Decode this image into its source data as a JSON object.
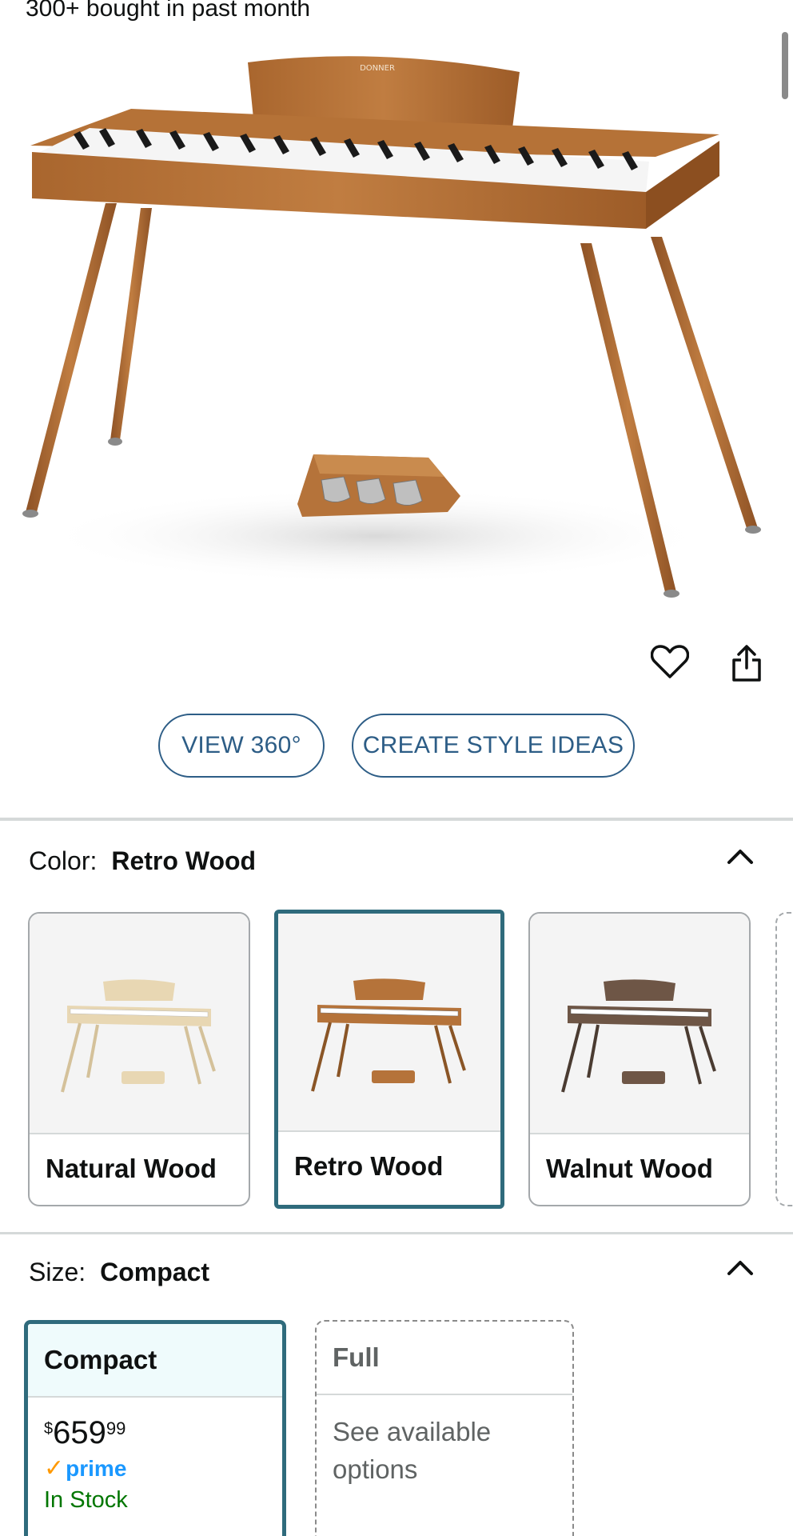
{
  "bought_text": "300+ bought in past month",
  "hero": {
    "brand": "DONNER"
  },
  "actions": {
    "heart_icon": "heart-icon",
    "share_icon": "share-icon"
  },
  "buttons": {
    "view360": "VIEW 360°",
    "style_ideas": "CREATE STYLE IDEAS"
  },
  "color": {
    "label": "Color:",
    "value": "Retro Wood",
    "options": [
      {
        "name": "Natural Wood",
        "wood": "#e8d7b3",
        "legs": "#d4c19a",
        "selected": false
      },
      {
        "name": "Retro Wood",
        "wood": "#b5733a",
        "legs": "#8a5526",
        "selected": true
      },
      {
        "name": "Walnut Wood",
        "wood": "#6e5646",
        "legs": "#4a3b31",
        "selected": false
      }
    ]
  },
  "size": {
    "label": "Size:",
    "value": "Compact",
    "options": [
      {
        "name": "Compact",
        "price_symbol": "$",
        "price_whole": "659",
        "price_cents": "99",
        "prime": "prime",
        "stock": "In Stock"
      },
      {
        "name": "Full",
        "availability": "See available options"
      }
    ]
  },
  "colors": {
    "link": "#2d5d86",
    "selected_border": "#2f6b7c",
    "in_stock": "#007600",
    "prime_blue": "#1a98ff",
    "prime_check": "#ff9900"
  }
}
